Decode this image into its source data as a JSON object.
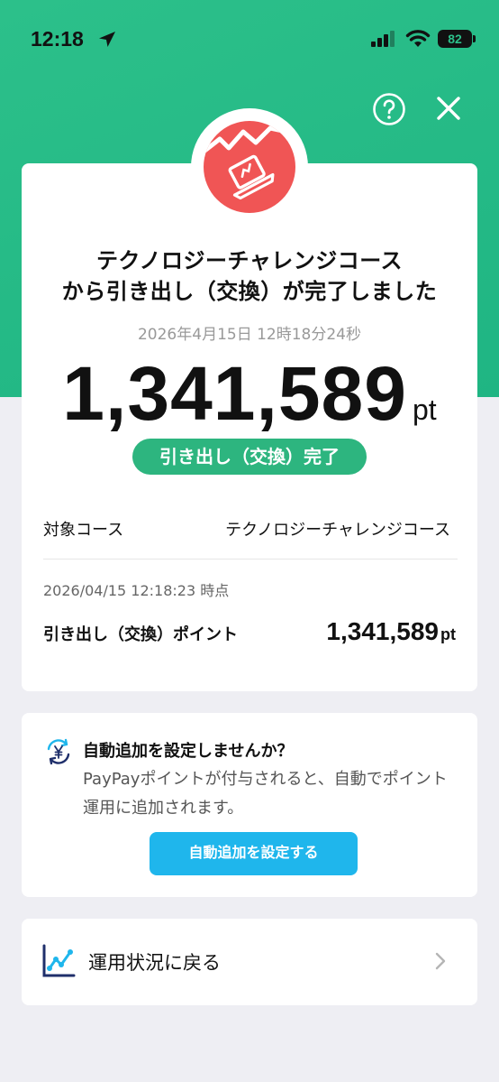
{
  "status_bar": {
    "time": "12:18",
    "battery": "82"
  },
  "result": {
    "title_line1": "テクノロジーチャレンジコース",
    "title_line2": "から引き出し（交換）が完了しました",
    "datetime": "2026年4月15日 12時18分24秒",
    "amount": "1,341,589",
    "amount_unit": "pt",
    "status": "引き出し（交換）完了",
    "course_label": "対象コース",
    "course_value": "テクノロジーチャレンジコース",
    "as_of": "2026/04/15 12:18:23 時点",
    "points_label": "引き出し（交換）ポイント",
    "points_value": "1,341,589",
    "points_unit": "pt"
  },
  "auto_add": {
    "title": "自動追加を設定しませんか？",
    "desc": "PayPayポイントが付与されると、自動でポイント運用に追加されます。",
    "button": "自動追加を設定する"
  },
  "back": {
    "label": "運用状況に戻る"
  },
  "colors": {
    "brand_green": "#2cc08a",
    "status_green": "#2db57f",
    "badge_red": "#f05555",
    "button_blue": "#1fb6ec",
    "chart_navy": "#1f2f6b"
  }
}
